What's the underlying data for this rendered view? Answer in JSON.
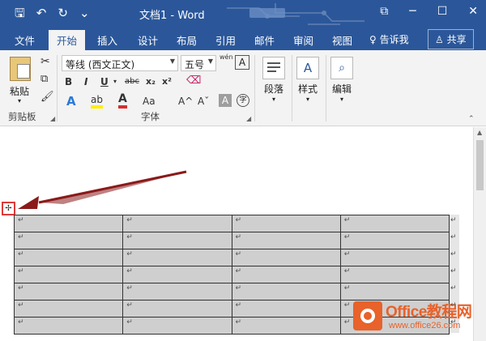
{
  "window": {
    "title": "文档1  -  Word",
    "qat": {
      "save": "🖫",
      "undo": "↶",
      "redo": "↻",
      "customize": "⌄"
    },
    "controls": {
      "ribbon_options": "⧉",
      "minimize": "─",
      "maximize": "☐",
      "close": "✕"
    }
  },
  "tabs": [
    {
      "label": "文件"
    },
    {
      "label": "开始"
    },
    {
      "label": "插入"
    },
    {
      "label": "设计"
    },
    {
      "label": "布局"
    },
    {
      "label": "引用"
    },
    {
      "label": "邮件"
    },
    {
      "label": "审阅"
    },
    {
      "label": "视图"
    }
  ],
  "tell_me": "♀ 告诉我",
  "share": "♙ 共享",
  "ribbon": {
    "clipboard": {
      "paste_label": "粘贴",
      "group_label": "剪贴板"
    },
    "font": {
      "font_name": "等线 (西文正文)",
      "font_size": "五号",
      "wen_label": "wén",
      "group_label": "字体",
      "bold": "B",
      "italic": "I",
      "underline": "U",
      "strike": "abc",
      "subscript": "x₂",
      "superscript": "x²",
      "change_case": "Aa",
      "grow": "A^",
      "shrink": "Aˇ",
      "char_shading": "A",
      "enclose": "字"
    },
    "paragraph": {
      "label": "段落"
    },
    "styles": {
      "label": "样式"
    },
    "editing": {
      "label": "编辑"
    }
  },
  "document": {
    "table_move_handle": "✢",
    "cell_mark": "↵",
    "rows": 7,
    "cols": 4
  },
  "watermark": {
    "title": "Office教程网",
    "url": "www.office26.com"
  },
  "colors": {
    "word_blue": "#2b579a",
    "table_fill": "#cfcfcf",
    "arrow": "#8b1a1a",
    "handle_border": "#e03a3a",
    "watermark": "#e8622a"
  }
}
